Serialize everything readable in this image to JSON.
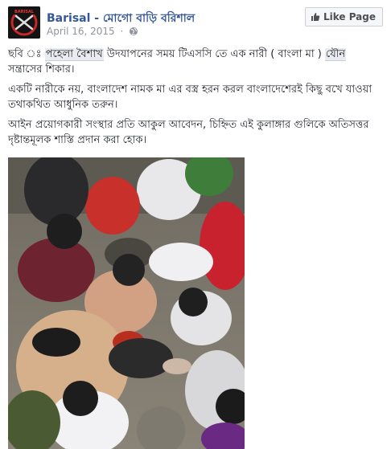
{
  "header": {
    "page_name": "Barisal",
    "page_name_sep": "-",
    "page_name_bn": "মোগো বাড়ি বরিশাল",
    "date": "April 16, 2015",
    "dot": "·",
    "avatar_text": "BARISAL",
    "like_label": "Like Page"
  },
  "post": {
    "p1_a": "ছবি ঃ ",
    "p1_hl1": "পহেলা বৈশাখ",
    "p1_b": " উদযাপনের সময় টিএসসি তে এক নারী ( বাংলা মা ) ",
    "p1_hl2": "যৌন",
    "p1_c": " সন্ত্রাসের শিকার।",
    "p2": "একটি নারীকে নয়, বাংলাদেশ নামক মা এর বস্ত্র হরন করল বাংলাদেশেরই কিছু বখে যাওয়া তথাকথিত আধুনিক তরুন।",
    "p3": "আইন প্রয়োগকারী সংস্থার প্রতি আকুল আবেদন, চিহ্নিত এই কুলাঙ্গার গুলিকে অতিসত্তর দৃষ্টান্তমূলক শাস্তি প্রদান করা হোক।"
  },
  "icons": [
    "globe-icon",
    "like-thumb-icon"
  ],
  "colors": {
    "link": "#365899",
    "meta": "#90949c",
    "text": "#1d2129"
  }
}
